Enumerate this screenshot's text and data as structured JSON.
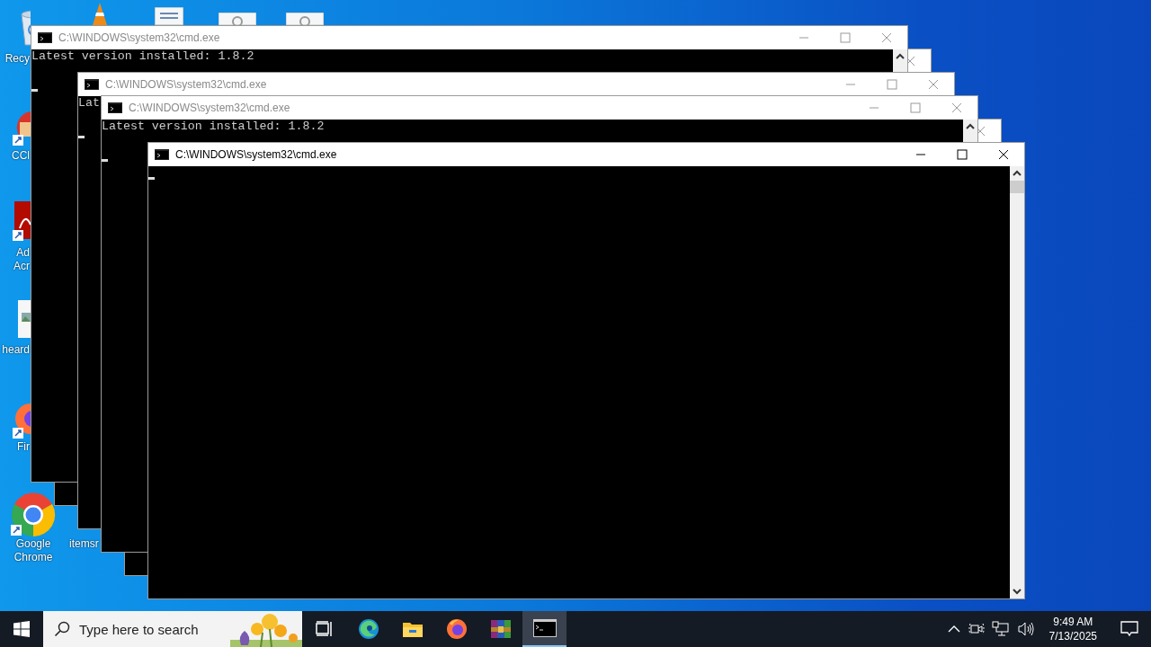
{
  "desktop_icons": [
    {
      "kind": "recycle",
      "label": "Recy"
    },
    {
      "kind": "cone"
    },
    {
      "kind": "doc"
    },
    {
      "kind": "gearfile"
    },
    {
      "kind": "gearfile"
    },
    {
      "kind": "ccleaner",
      "label": "CCl"
    },
    {
      "kind": "acrobat",
      "label": "Ad Acr"
    },
    {
      "kind": "image",
      "label": "heard"
    },
    {
      "kind": "firefox",
      "label": "Fir"
    },
    {
      "kind": "chrome",
      "label": "Google Chrome"
    },
    {
      "kind": "blank",
      "label": "itemsr"
    }
  ],
  "windows": [
    {
      "title": "C:\\WINDOWS\\system32\\cmd.exe",
      "active": false,
      "lines": [
        "Latest version installed: 1.8.2"
      ]
    },
    {
      "active": false
    },
    {
      "title": "C:\\WINDOWS\\system32\\cmd.exe",
      "active": false,
      "lines": [
        "Lat"
      ]
    },
    {
      "title": "C:\\WINDOWS\\system32\\cmd.exe",
      "active": false,
      "lines": [
        "Latest version installed: 1.8.2"
      ]
    },
    {
      "active": false
    },
    {
      "title": "C:\\WINDOWS\\system32\\cmd.exe",
      "active": true
    }
  ],
  "taskbar": {
    "search": {
      "placeholder": "Type here to search"
    },
    "apps": [
      {
        "kind": "taskview",
        "selected": false
      },
      {
        "kind": "edge",
        "selected": false
      },
      {
        "kind": "explorer",
        "selected": false
      },
      {
        "kind": "firefox",
        "selected": false
      },
      {
        "kind": "winrar",
        "selected": false
      },
      {
        "kind": "cmd",
        "selected": true
      }
    ],
    "time": "9:49 AM",
    "date": "7/13/2025"
  }
}
